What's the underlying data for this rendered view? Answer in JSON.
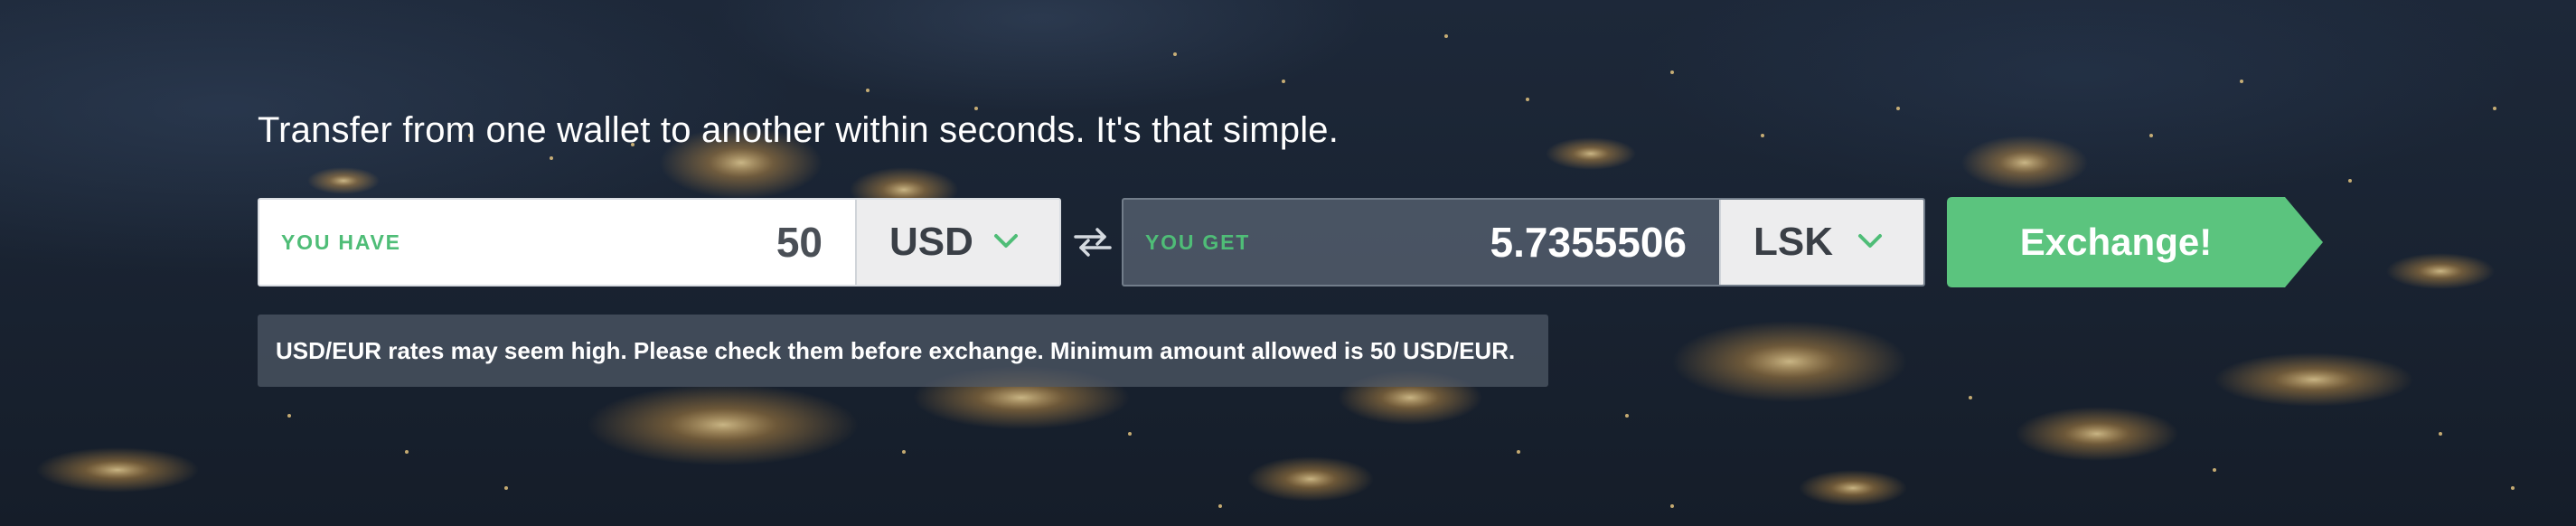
{
  "tagline": "Transfer from one wallet to another within seconds. It's that simple.",
  "have": {
    "label": "YOU HAVE",
    "amount": "50",
    "currency": "USD"
  },
  "get": {
    "label": "YOU GET",
    "amount": "5.7355506",
    "currency": "LSK"
  },
  "exchange_button": {
    "label": "Exchange!"
  },
  "notice": "USD/EUR rates may seem high. Please check them before exchange. Minimum amount allowed is 50 USD/EUR.",
  "icons": {
    "swap": "swap-arrows-icon",
    "dropdown": "chevron-down-icon"
  },
  "colors": {
    "accent": "#4fbd77",
    "button": "#5bc47e",
    "background": "#1a2433"
  }
}
